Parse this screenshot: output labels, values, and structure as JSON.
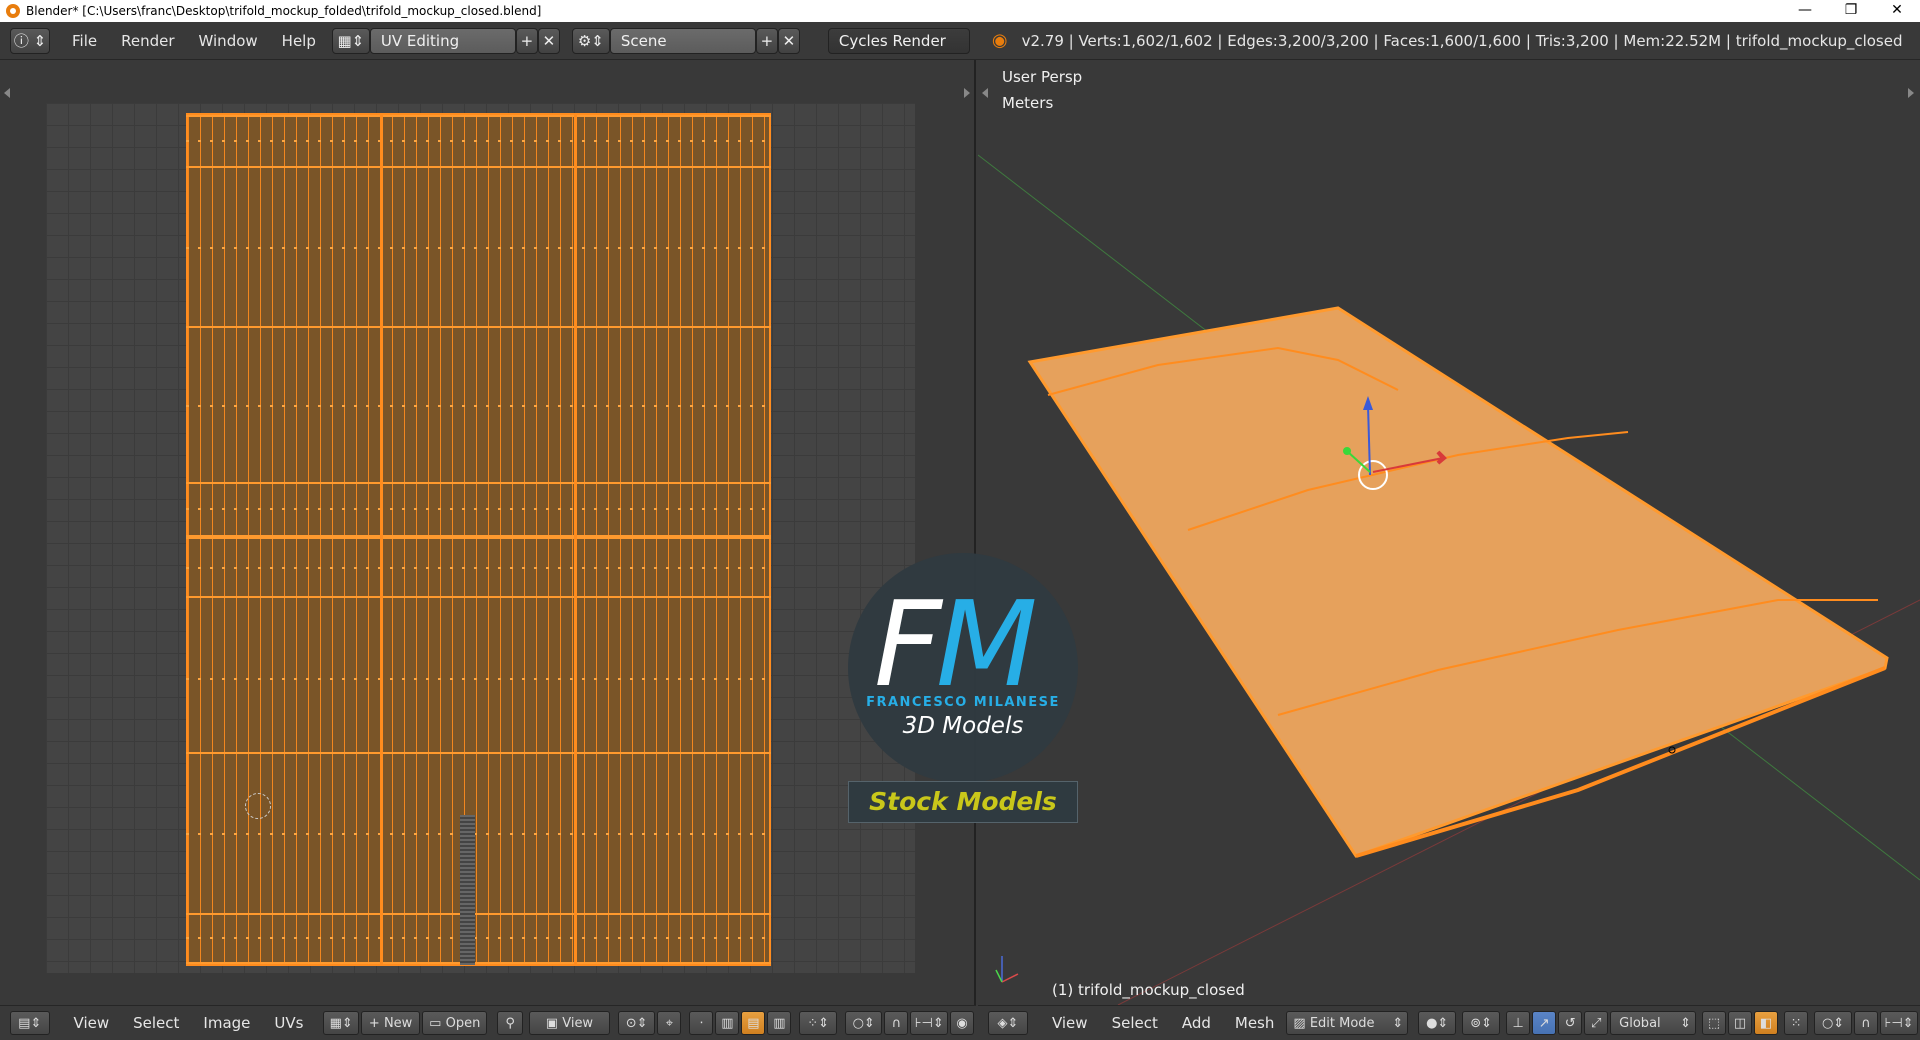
{
  "window": {
    "title": "Blender* [C:\\Users\\franc\\Desktop\\trifold_mockup_folded\\trifold_mockup_closed.blend]",
    "minimize": "—",
    "restore": "❐",
    "close": "✕"
  },
  "menu": {
    "items": [
      "File",
      "Render",
      "Window",
      "Help"
    ]
  },
  "screen_layout": {
    "value": "UV Editing"
  },
  "scene": {
    "value": "Scene"
  },
  "render_engine": {
    "value": "Cycles Render"
  },
  "stats": "v2.79 | Verts:1,602/1,602 | Edges:3,200/3,200 | Faces:1,600/1,600 | Tris:3,200 | Mem:22.52M | trifold_mockup_closed",
  "viewport": {
    "persp_label": "User Persp",
    "units_label": "Meters",
    "object_label": "(1) trifold_mockup_closed"
  },
  "uv_footer": {
    "items": [
      "View",
      "Select",
      "Image",
      "UVs"
    ],
    "new_label": "New",
    "open_label": "Open",
    "view_label": "View"
  },
  "view3d_footer": {
    "items": [
      "View",
      "Select",
      "Add",
      "Mesh"
    ],
    "mode_label": "Edit Mode",
    "orientation_label": "Global"
  },
  "watermark": {
    "letter_f": "F",
    "letter_m": "M",
    "name": "FRANCESCO MILANESE",
    "subtitle": "3D Models",
    "badge": "Stock Models"
  },
  "colors": {
    "accent_orange": "#ff8c1e",
    "brand_blue": "#27aee6",
    "badge_yellow": "#c9c71a"
  }
}
